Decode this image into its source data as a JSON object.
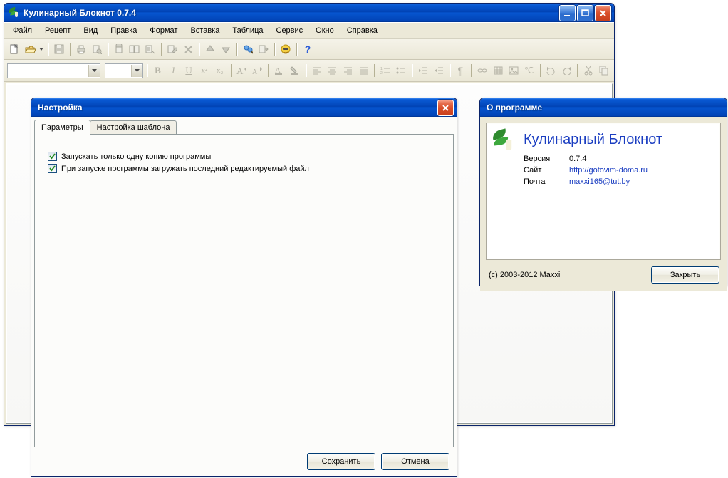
{
  "mainWindow": {
    "title": "Кулинарный Блокнот 0.7.4",
    "menus": [
      "Файл",
      "Рецепт",
      "Вид",
      "Правка",
      "Формат",
      "Вставка",
      "Таблица",
      "Сервис",
      "Окно",
      "Справка"
    ]
  },
  "formatBar": {
    "bold": "B",
    "italic": "I",
    "underline": "U",
    "super": "x²",
    "sub": "x₂"
  },
  "settingsDialog": {
    "title": "Настройка",
    "tabs": [
      "Параметры",
      "Настройка шаблона"
    ],
    "options": {
      "singleInstance": "Запускать только одну копию программы",
      "loadLastFile": "При запуске программы загружать последний редактируемый файл"
    },
    "buttons": {
      "save": "Сохранить",
      "cancel": "Отмена"
    }
  },
  "aboutDialog": {
    "title": "О программе",
    "appName": "Кулинарный Блокнот",
    "rows": {
      "versionLabel": "Версия",
      "versionValue": "0.7.4",
      "siteLabel": "Сайт",
      "siteValue": "http://gotovim-doma.ru",
      "mailLabel": "Почта",
      "mailValue": "maxxi165@tut.by"
    },
    "copyright": "(c) 2003-2012 Maxxi",
    "close": "Закрыть"
  }
}
